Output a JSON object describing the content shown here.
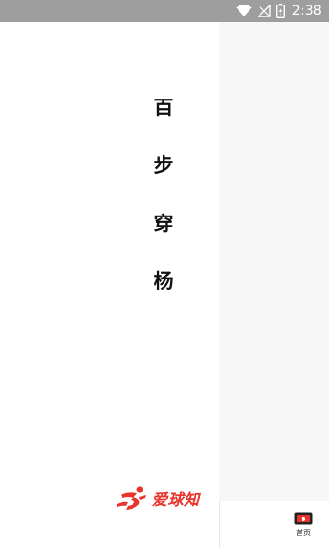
{
  "status_bar": {
    "time": "2:38",
    "icons": [
      "wifi-icon",
      "signal-off-icon",
      "battery-charging-icon"
    ]
  },
  "title": {
    "chars": [
      "百",
      "步",
      "穿",
      "杨"
    ]
  },
  "brand": {
    "name": "爱球知",
    "color": "#e8342c"
  },
  "bottom_nav": {
    "home_label": "首页"
  }
}
